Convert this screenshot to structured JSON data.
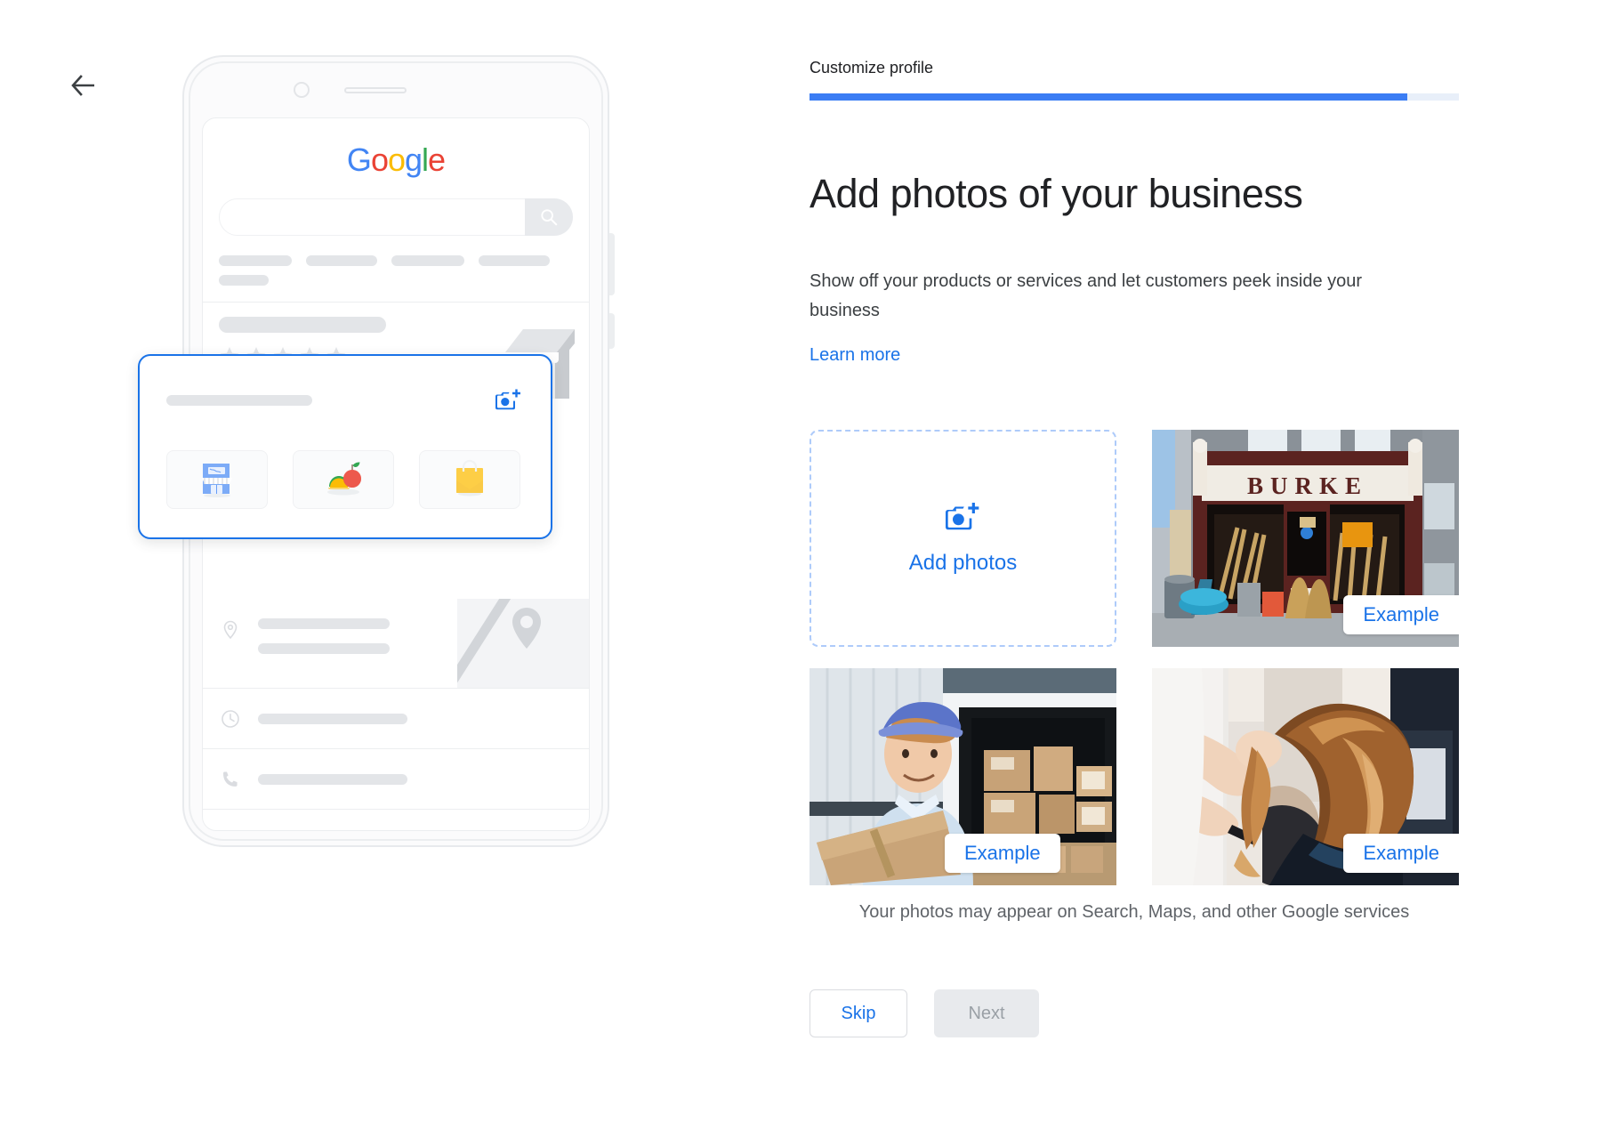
{
  "nav": {
    "back_icon": "arrow-left-icon"
  },
  "header": {
    "step_label": "Customize profile",
    "progress_percent": 92
  },
  "main": {
    "title": "Add photos of your business",
    "description": "Show off your products or services and let customers peek inside your business",
    "learn_more": "Learn more",
    "add_photos_label": "Add photos",
    "add_photos_icon": "camera-plus-icon",
    "examples": [
      {
        "badge": "Example",
        "alt": "storefront of hardware store with sign BURKE"
      },
      {
        "badge": "Example",
        "alt": "delivery person holding a cardboard box in front of a van"
      },
      {
        "badge": "Example",
        "alt": "hairdresser styling a client's long hair in a salon"
      }
    ],
    "storefront_sign_text": "BURKE",
    "disclaimer": "Your photos may appear on Search, Maps, and other Google services"
  },
  "footer": {
    "skip_label": "Skip",
    "next_label": "Next"
  },
  "preview": {
    "google_logo_letters": [
      "G",
      "o",
      "o",
      "g",
      "l",
      "e"
    ],
    "search_icon": "magnifier-icon",
    "card_camera_icon": "camera-plus-icon",
    "tiles": [
      "storefront-tile-icon",
      "food-tile-icon",
      "shopping-bag-tile-icon"
    ],
    "rows": [
      {
        "icon": "location-pin-icon"
      },
      {
        "icon": "clock-icon"
      },
      {
        "icon": "phone-icon"
      },
      {
        "icon": "globe-icon"
      }
    ],
    "rating_stars": 5
  },
  "colors": {
    "accent_blue": "#1a73e8",
    "progress_blue": "#3b7df4",
    "progress_track": "#e8eff9",
    "dashed_border": "#aecbfa",
    "placeholder_gray": "#e3e5e8",
    "text_primary": "#202124",
    "text_secondary": "#5f6368",
    "disabled_bg": "#e8eaed"
  }
}
